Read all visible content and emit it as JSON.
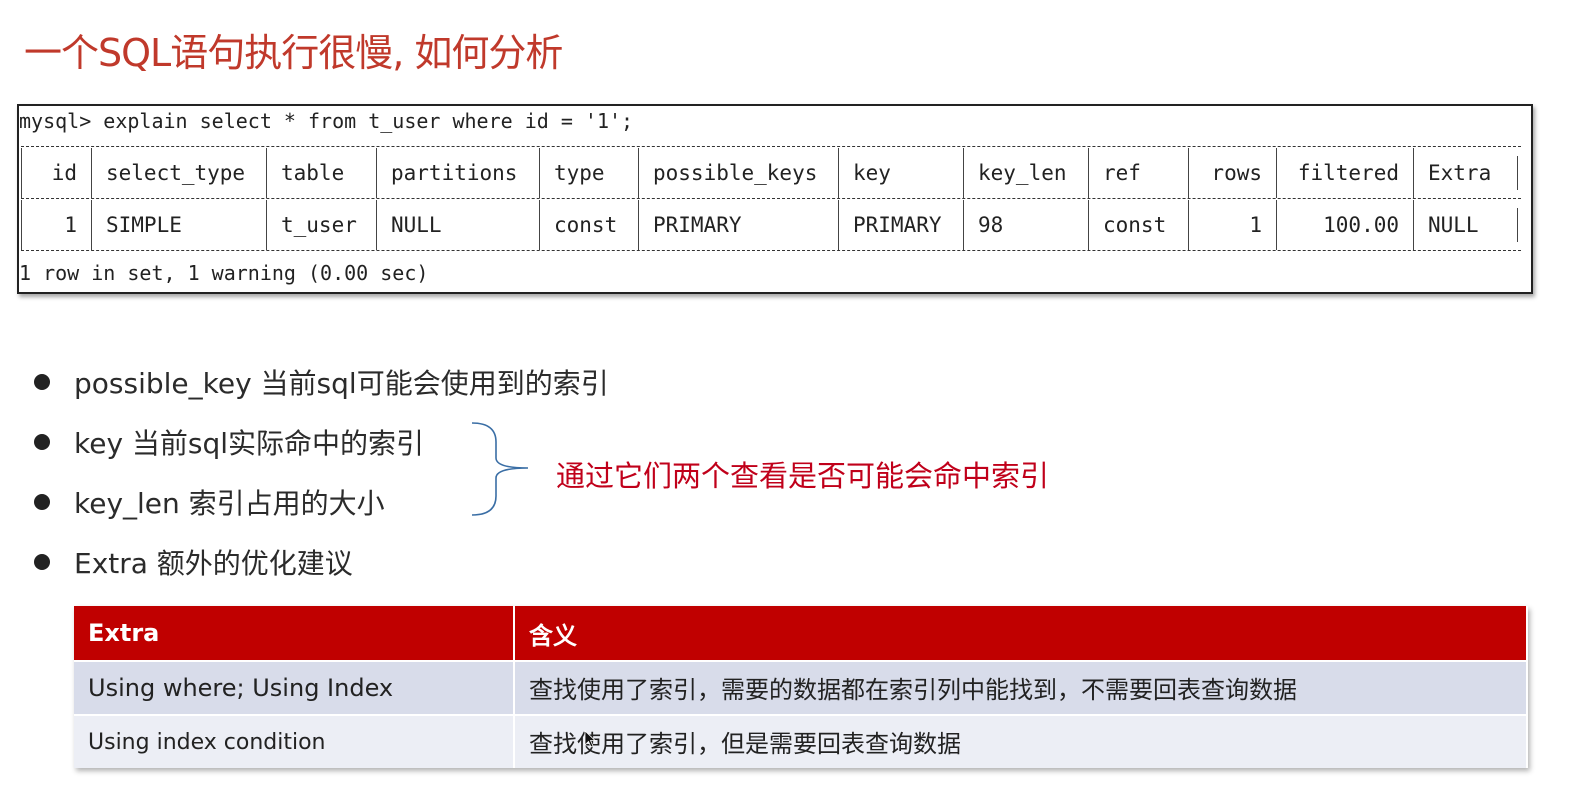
{
  "title": "一个SQL语句执行很慢, 如何分析",
  "terminal": {
    "command": "mysql> explain select * from t_user where id = '1';",
    "headers": [
      "id",
      "select_type",
      "table",
      "partitions",
      "type",
      "possible_keys",
      "key",
      "key_len",
      "ref",
      "rows",
      "filtered",
      "Extra"
    ],
    "row": [
      "1",
      "SIMPLE",
      "t_user",
      "NULL",
      "const",
      "PRIMARY",
      "PRIMARY",
      "98",
      "const",
      "1",
      "100.00",
      "NULL"
    ],
    "footer": "1 row in set, 1 warning (0.00 sec)"
  },
  "bullets": [
    "possible_key  当前sql可能会使用到的索引",
    "key 当前sql实际命中的索引",
    "key_len 索引占用的大小",
    "Extra 额外的优化建议"
  ],
  "note": "通过它们两个查看是否可能会命中索引",
  "extra_table": {
    "headers": [
      "Extra",
      "含义"
    ],
    "rows": [
      [
        "Using where; Using Index",
        "查找使用了索引，需要的数据都在索引列中能找到，不需要回表查询数据"
      ],
      [
        "Using index condition",
        "查找使用了索引，但是需要回表查询数据"
      ]
    ]
  },
  "colors": {
    "title": "#c0392b",
    "note": "#c0001a",
    "table_header": "#c00000",
    "row1": "#d8dcea",
    "row2": "#eceef5"
  }
}
